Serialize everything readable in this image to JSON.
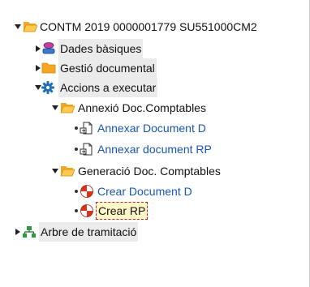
{
  "tree": {
    "root": {
      "label": "CONTM 2019 0000001779 SU551000CM2"
    },
    "dades_basiques": {
      "label": "Dades bàsiques"
    },
    "gestio_documental": {
      "label": "Gestió documental"
    },
    "accions": {
      "label": "Accions a executar"
    },
    "annexio": {
      "label": "Annexió Doc.Comptables"
    },
    "annexar_d": {
      "label": "Annexar Document D"
    },
    "annexar_rp": {
      "label": "Annexar document RP"
    },
    "generacio": {
      "label": "Generació Doc. Comptables"
    },
    "crear_d": {
      "label": "Crear Document D"
    },
    "crear_rp": {
      "label": "Crear RP"
    },
    "arbre": {
      "label": "Arbre de tramitació"
    }
  },
  "icons": {
    "expanded": "triangle-down-icon",
    "collapsed": "triangle-right-icon",
    "folder": "folder-icon",
    "open_folder": "folder-open-icon",
    "basic_data": "user-data-icon",
    "actions": "gear-icon",
    "document": "document-icon",
    "execute": "execute-icon",
    "hierarchy": "hierarchy-icon"
  },
  "colors": {
    "link": "#1a55b4",
    "folder": "#f5a623",
    "gear": "#1f6fb5",
    "execute": "#d8341c",
    "selection_bg": "#fff7c8",
    "highlight_bg": "#ebebeb"
  }
}
